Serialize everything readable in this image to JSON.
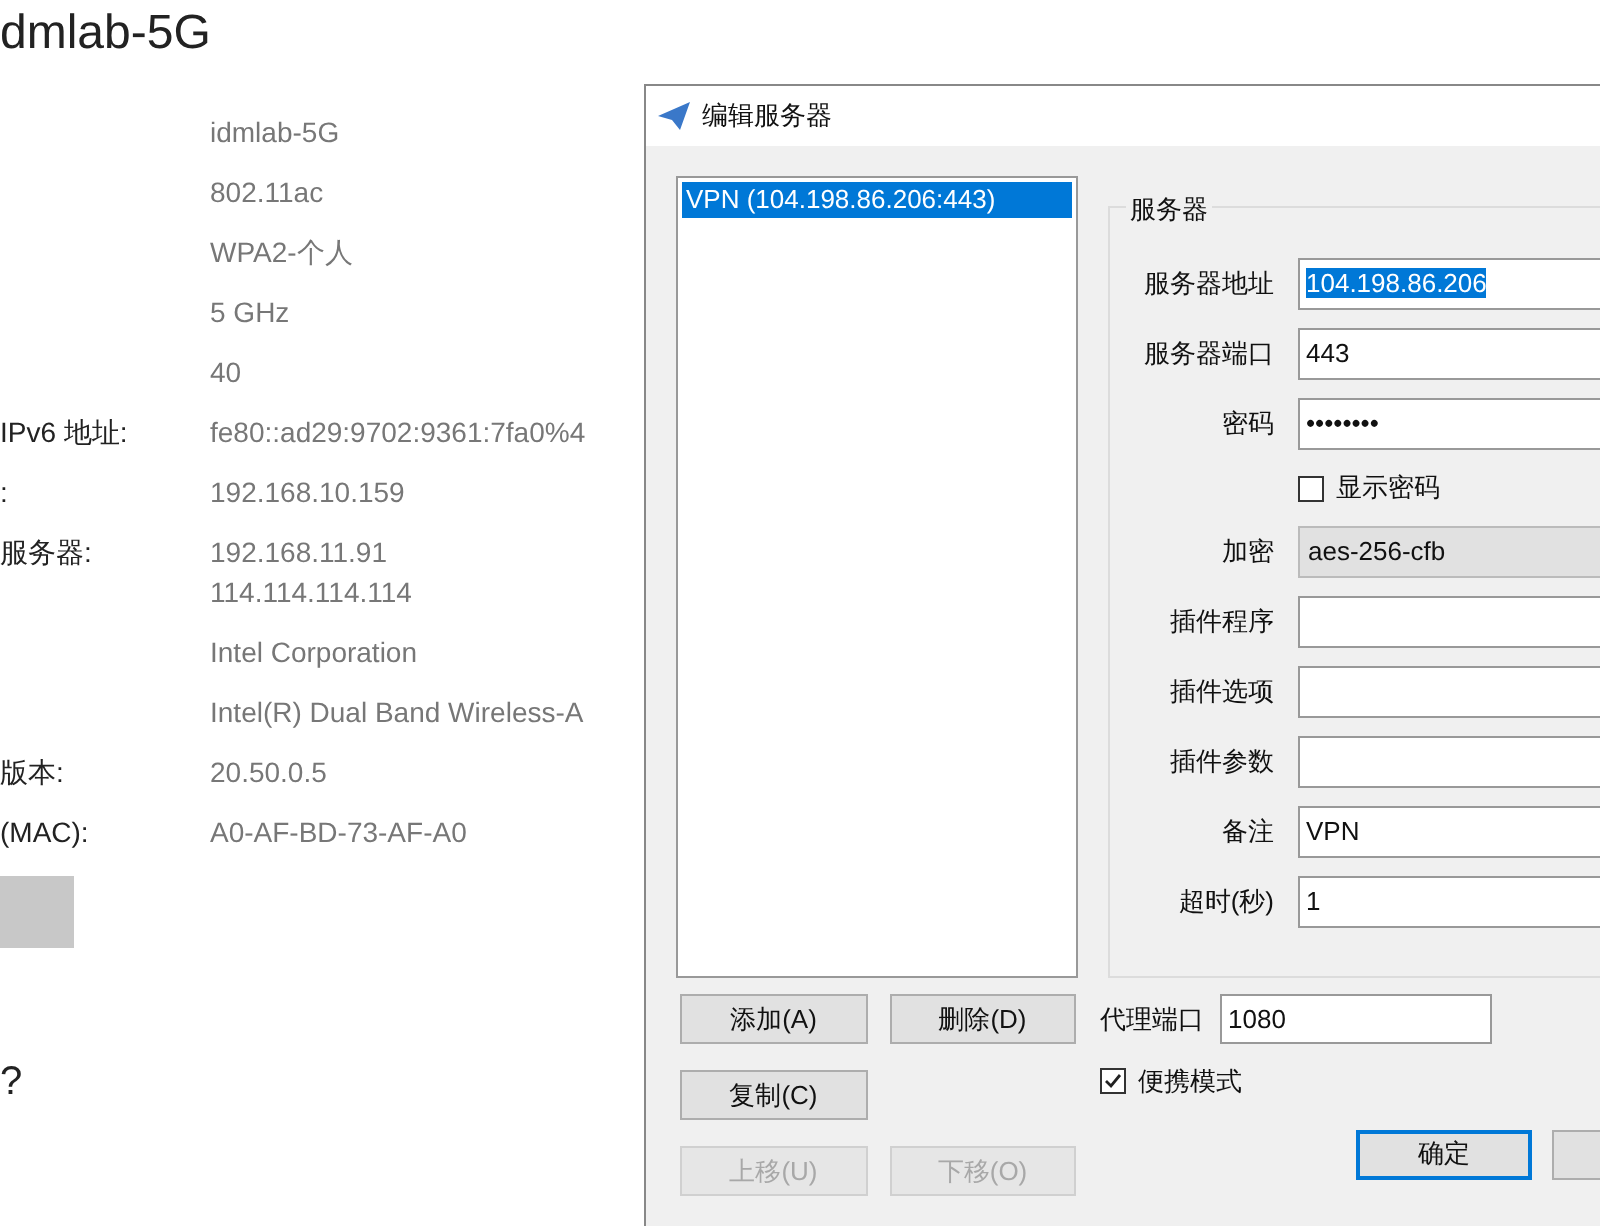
{
  "page": {
    "title": "dmlab-5G",
    "properties": [
      {
        "values": [
          "idmlab-5G"
        ]
      },
      {
        "values": [
          "802.11ac"
        ]
      },
      {
        "values": [
          "WPA2-个人"
        ]
      },
      {
        "values": [
          "5 GHz"
        ]
      },
      {
        "values": [
          "40"
        ]
      },
      {
        "label": "IPv6 地址:",
        "values": [
          "fe80::ad29:9702:9361:7fa0%4"
        ]
      },
      {
        "label": ":",
        "values": [
          "192.168.10.159"
        ]
      },
      {
        "label": "服务器:",
        "values": [
          "192.168.11.91",
          "114.114.114.114"
        ]
      },
      {
        "values": [
          "Intel Corporation"
        ]
      },
      {
        "values": [
          "Intel(R) Dual Band Wireless-A"
        ]
      },
      {
        "label": "版本:",
        "values": [
          "20.50.0.5"
        ]
      },
      {
        "label": "(MAC):",
        "values": [
          "A0-AF-BD-73-AF-A0"
        ]
      }
    ],
    "question": "?"
  },
  "dialog": {
    "title": "编辑服务器",
    "servers": [
      {
        "label": "VPN (104.198.86.206:443)",
        "selected": true
      }
    ],
    "group_title": "服务器",
    "fields": [
      {
        "kind": "text",
        "label": "服务器地址",
        "value": "104.198.86.206",
        "text_selected": true
      },
      {
        "kind": "text",
        "label": "服务器端口",
        "value": "443"
      },
      {
        "kind": "text",
        "label": "密码",
        "value": "••••••••"
      },
      {
        "kind": "checkbox",
        "label": "显示密码",
        "checked": false
      },
      {
        "kind": "select",
        "label": "加密",
        "value": "aes-256-cfb"
      },
      {
        "kind": "text",
        "label": "插件程序"
      },
      {
        "kind": "text",
        "label": "插件选项"
      },
      {
        "kind": "text",
        "label": "插件参数"
      },
      {
        "kind": "text",
        "label": "备注",
        "value": "VPN"
      },
      {
        "kind": "text",
        "label": "超时(秒)",
        "value": "1"
      }
    ],
    "list_buttons": [
      {
        "label": "添加(A)",
        "disabled": false
      },
      {
        "label": "删除(D)",
        "disabled": false
      },
      {
        "label": "复制(C)",
        "disabled": false
      },
      {
        "label": "上移(U)",
        "disabled": true
      },
      {
        "label": "下移(O)",
        "disabled": true
      }
    ],
    "proxy_port": {
      "label": "代理端口",
      "value": "1080"
    },
    "portable_mode": {
      "label": "便携模式",
      "checked": true
    },
    "ok_button": "确定"
  }
}
